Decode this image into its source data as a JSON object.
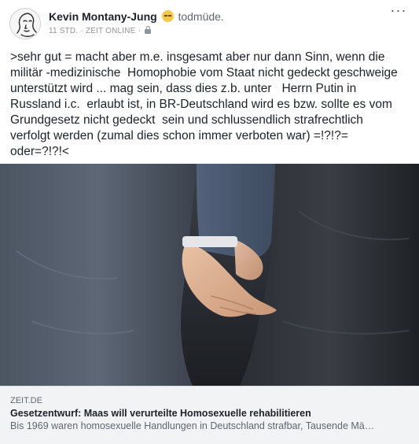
{
  "post": {
    "author": "Kevin Montany-Jung",
    "mood_icon": "sleepy-face-emoji",
    "mood": "todmüde.",
    "meta": {
      "time": "11 STD.",
      "source": "ZEIT ONLINE",
      "separator": "·",
      "privacy_icon": "lock-icon"
    },
    "more_label": "···",
    "text": ">sehr gut = macht aber m.e. insgesamt aber nur dann Sinn, wenn die\nmilitär -medizinische  Homophobie vom Staat nicht gedeckt geschweige\nunterstützt wird ... mag sein, dass dies z.b. unter   Herrn Putin in\nRussland i.c.  erlaubt ist, in BR-Deutschland wird es bzw. sollte es vom\nGrundgesetz nicht gedeckt  sein und schlussendlich strafrechtlich\nverfolgt werden (zumal dies schon immer verboten war) =!?!?=\noder=?!?!<"
  },
  "link": {
    "image_icon": "photo-two-men-holding-hands",
    "domain": "ZEIT.DE",
    "title": "Gesetzentwurf: Maas will verurteilte Homosexuelle rehabilitieren",
    "description": "Bis 1969 waren homosexuelle Handlungen in Deutschland strafbar, Tausende Mä…"
  },
  "colors": {
    "text": "#1d2129",
    "secondary": "#606770",
    "meta": "#90949c",
    "caption_bg": "#f2f3f5"
  }
}
